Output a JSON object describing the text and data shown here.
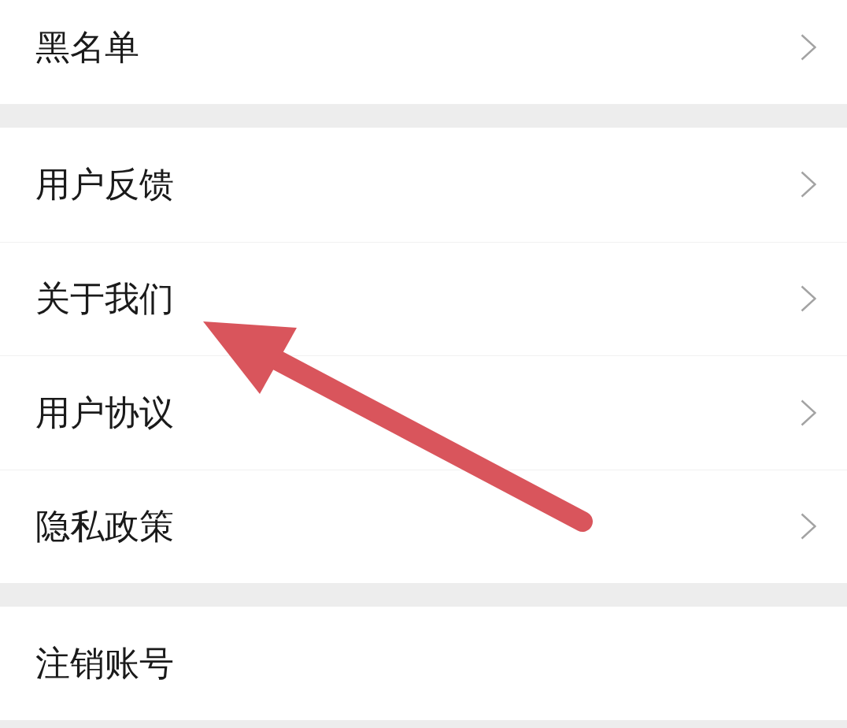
{
  "groups": [
    {
      "items": [
        {
          "label": "黑名单",
          "chevron": true
        }
      ]
    },
    {
      "items": [
        {
          "label": "用户反馈",
          "chevron": true
        },
        {
          "label": "关于我们",
          "chevron": true
        },
        {
          "label": "用户协议",
          "chevron": true
        },
        {
          "label": "隐私政策",
          "chevron": true
        }
      ]
    },
    {
      "items": [
        {
          "label": "注销账号",
          "chevron": false
        }
      ]
    }
  ]
}
